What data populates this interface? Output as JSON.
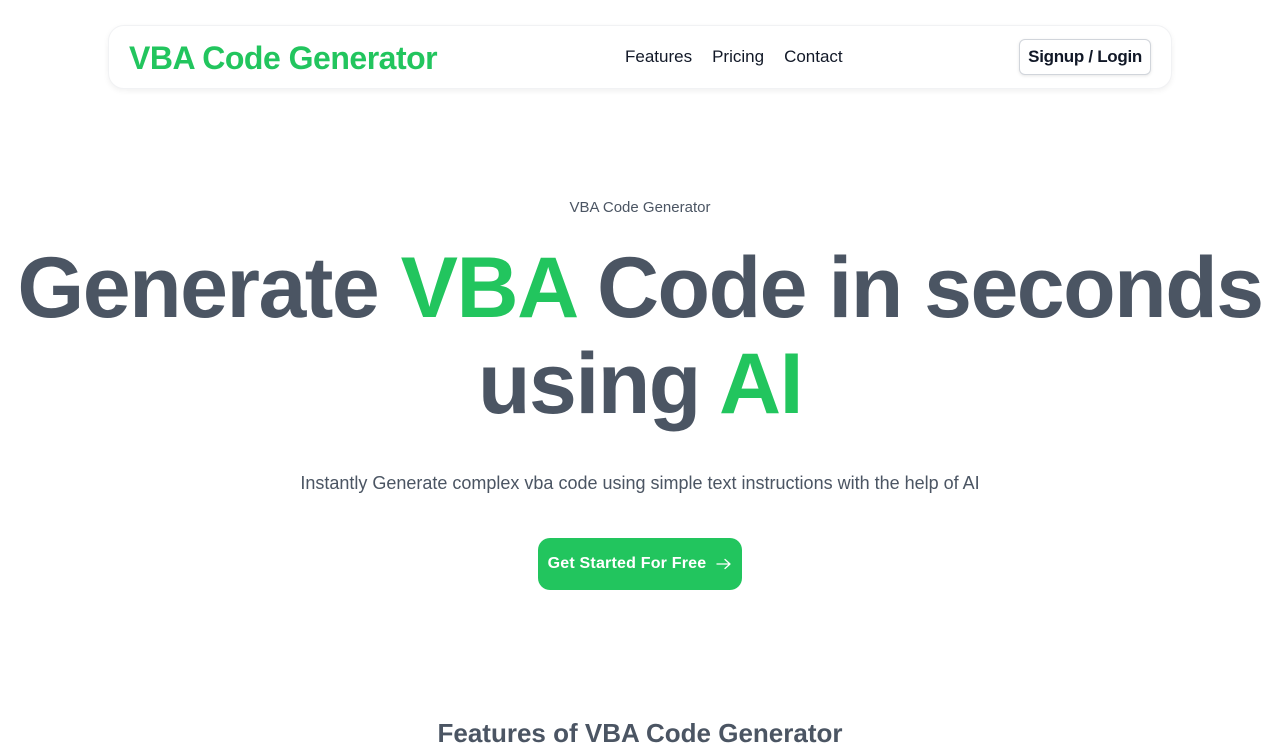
{
  "navbar": {
    "logo_text": "VBA Code Generator",
    "links": [
      "Features",
      "Pricing",
      "Contact"
    ],
    "auth_label": "Signup / Login"
  },
  "hero": {
    "eyebrow": "VBA Code Generator",
    "headline": {
      "part1": "Generate ",
      "accent1": "VBA",
      "part2": " Code in seconds",
      "part3": "using ",
      "accent2": "AI"
    },
    "subtext": "Instantly Generate complex vba code using simple text instructions with the help of AI",
    "cta_label": "Get Started For Free"
  },
  "features_section": {
    "title": "Features of VBA Code Generator"
  },
  "colors": {
    "accent": "#22c55e",
    "text": "#4b5563",
    "nav_text": "#111827"
  },
  "icons": {
    "cta_icon": "arrow-right-icon"
  }
}
